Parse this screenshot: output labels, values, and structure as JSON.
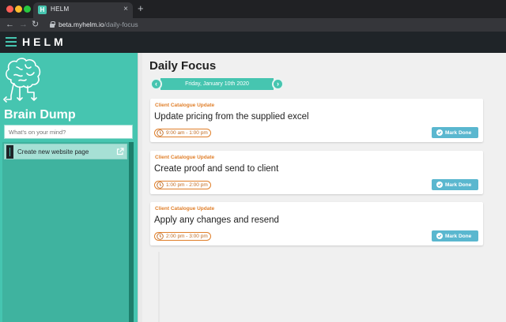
{
  "browser": {
    "tab_title": "HELM",
    "tab_favicon": "H",
    "tab_close": "×",
    "new_tab": "+",
    "url_host": "beta.myhelm.io",
    "url_path": "/daily-focus"
  },
  "app": {
    "logo": "HELM"
  },
  "sidebar": {
    "title": "Brain Dump",
    "input_placeholder": "What's on your mind?",
    "items": [
      {
        "label": "Create new website page"
      }
    ]
  },
  "main": {
    "title": "Daily Focus",
    "date": "Friday, January 10th 2020",
    "cards": [
      {
        "project": "Client Catalogue Update",
        "title": "Update pricing from the supplied excel",
        "time": "9:00 am - 1:00 pm",
        "button": "Mark Done"
      },
      {
        "project": "Client Catalogue Update",
        "title": "Create proof and send to client",
        "time": "1:00 pm - 2:00 pm",
        "button": "Mark Done"
      },
      {
        "project": "Client Catalogue Update",
        "title": "Apply any changes and resend",
        "time": "2:00 pm - 3:00 pm",
        "button": "Mark Done"
      }
    ]
  },
  "colors": {
    "accent": "#46c5b0",
    "header": "#1f2428",
    "project": "#e07f2a",
    "mark_done": "#5ab7cf"
  }
}
